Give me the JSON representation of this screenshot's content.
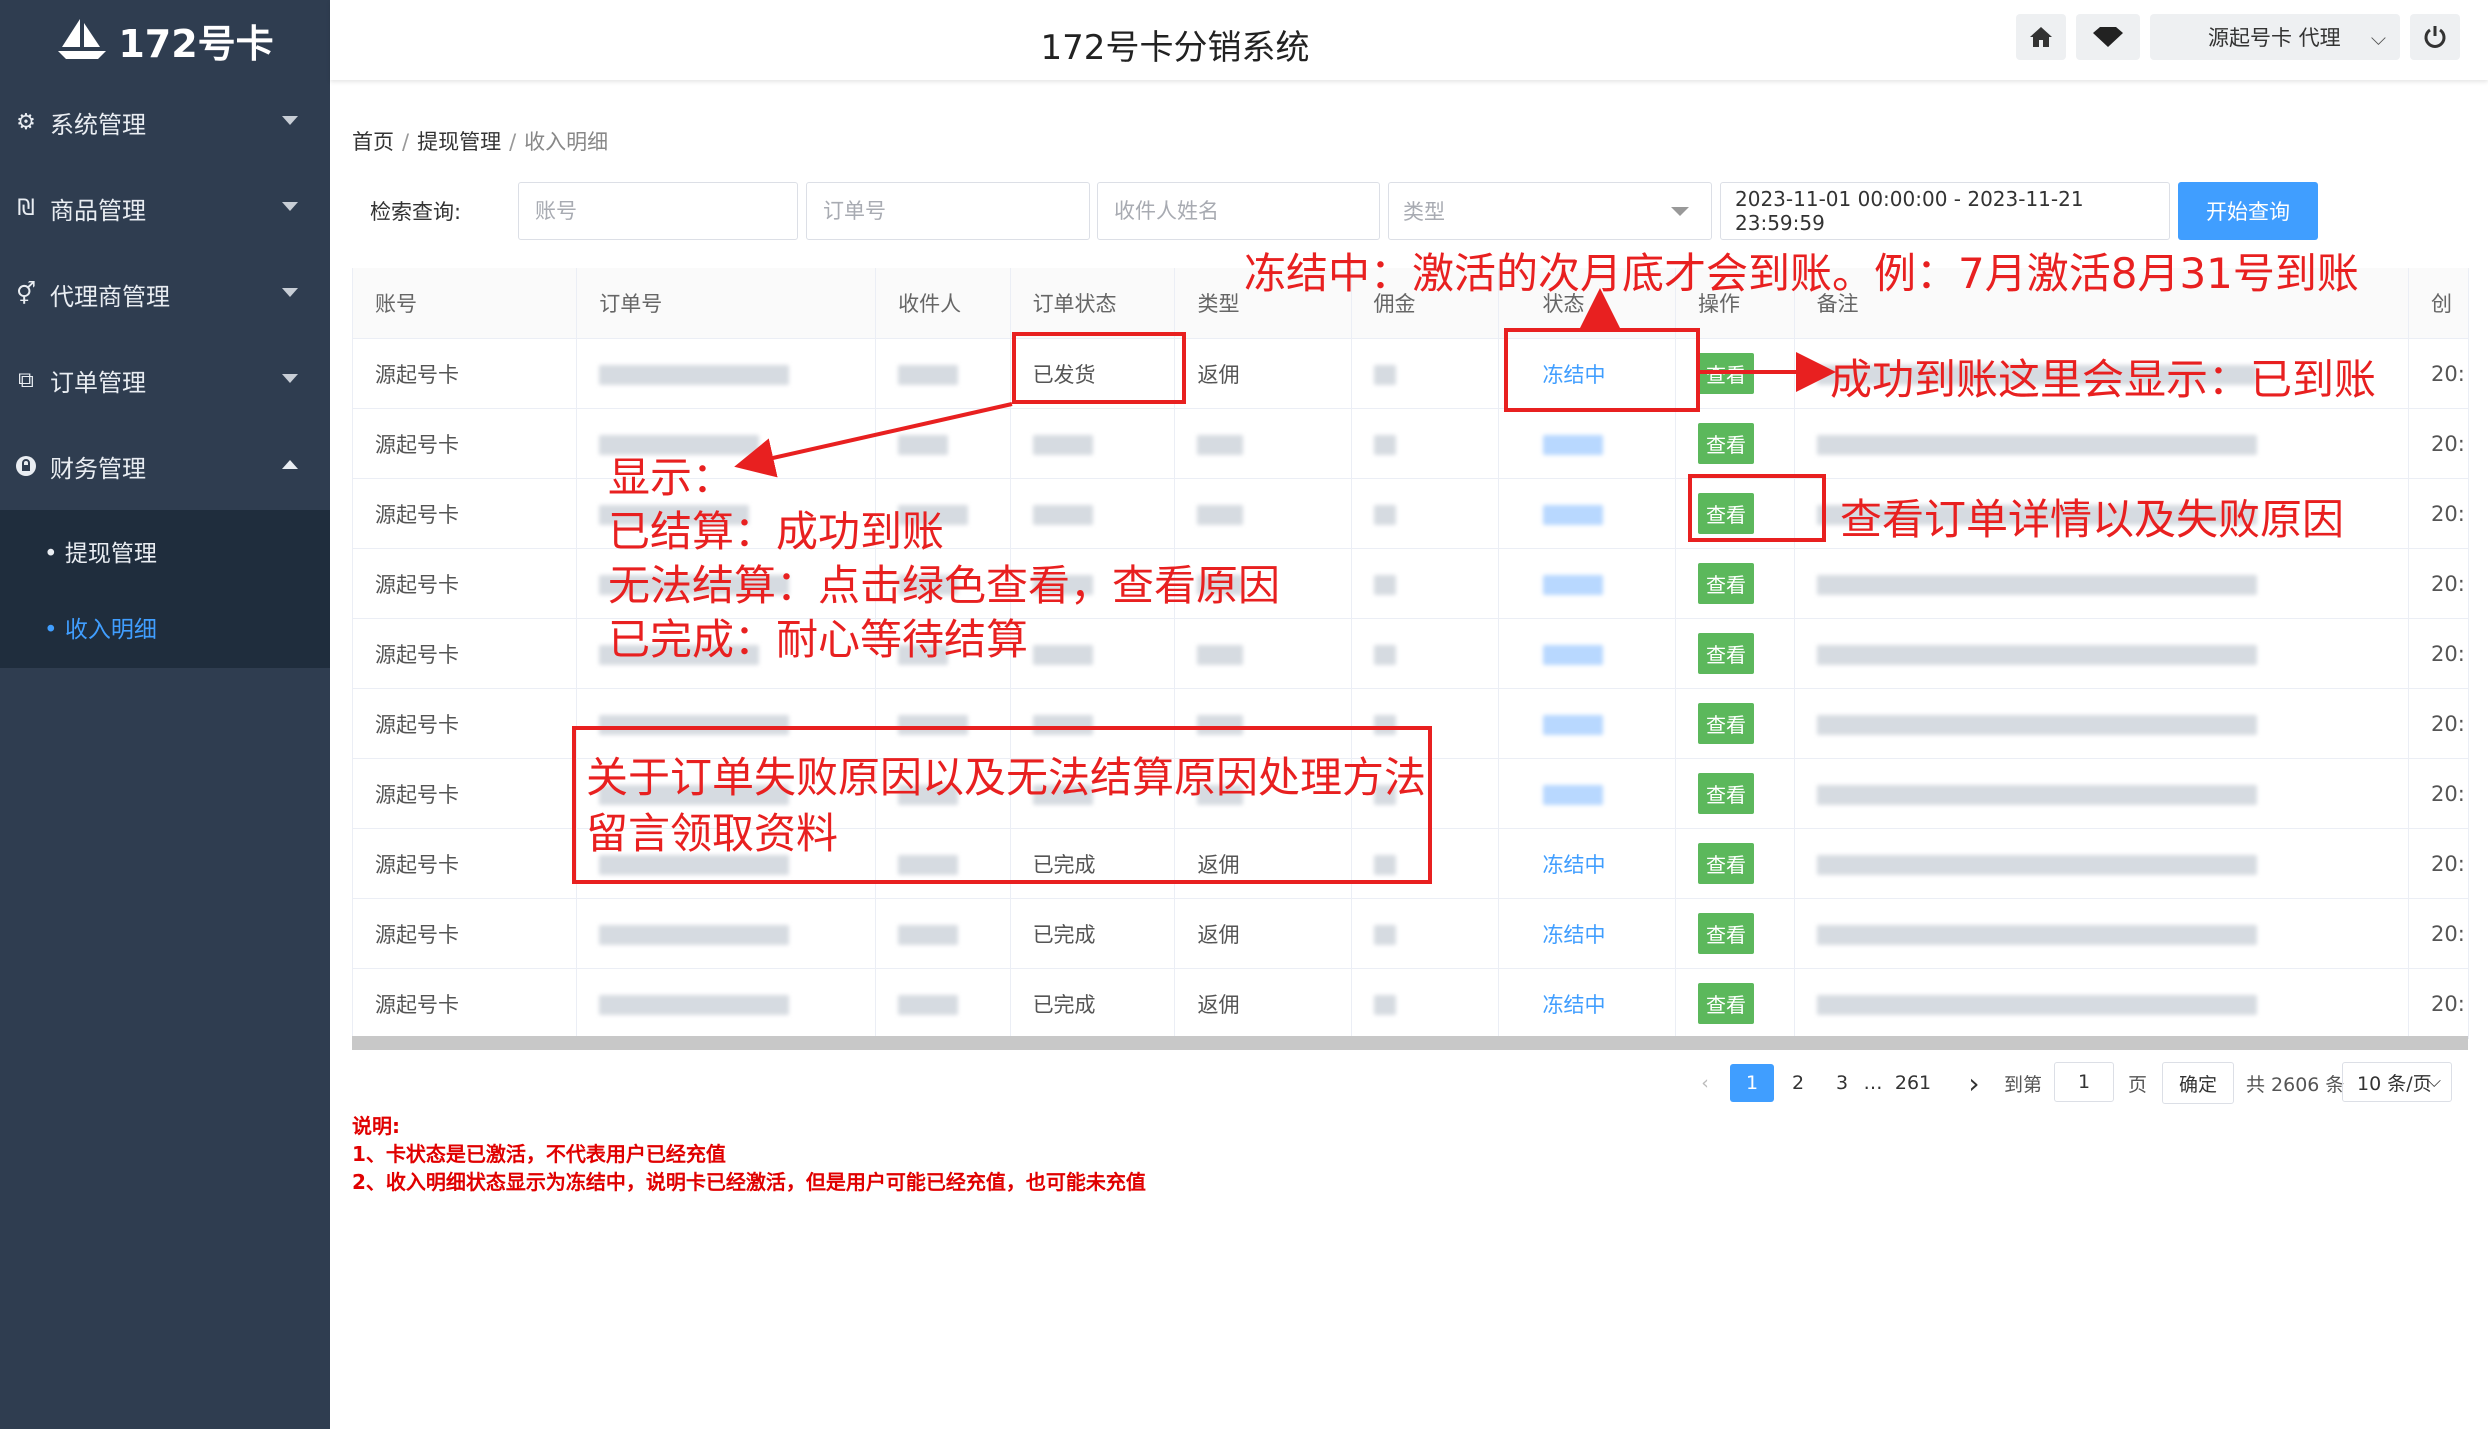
{
  "app": {
    "logo_text": "172号卡",
    "title": "172号卡分销系统",
    "user_label": "源起号卡 代理"
  },
  "sidebar": {
    "items": [
      {
        "label": "系统管理",
        "icon": "gear-icon"
      },
      {
        "label": "商品管理",
        "icon": "product-icon"
      },
      {
        "label": "代理商管理",
        "icon": "agent-icon"
      },
      {
        "label": "订单管理",
        "icon": "order-icon"
      },
      {
        "label": "财务管理",
        "icon": "finance-icon"
      }
    ],
    "sub_items": [
      {
        "label": "• 提现管理"
      },
      {
        "label": "• 收入明细",
        "active": true
      }
    ]
  },
  "breadcrumb": {
    "home": "首页",
    "sep": "/",
    "level2": "提现管理",
    "current": "收入明细"
  },
  "search": {
    "label": "检索查询:",
    "account_placeholder": "账号",
    "order_placeholder": "订单号",
    "recipient_placeholder": "收件人姓名",
    "type_placeholder": "类型",
    "date_range": "2023-11-01 00:00:00 - 2023-11-21 23:59:59",
    "button": "开始查询"
  },
  "table": {
    "columns": [
      "账号",
      "订单号",
      "收件人",
      "订单状态",
      "类型",
      "佣金",
      "状态",
      "操作",
      "备注",
      "创"
    ],
    "view_label": "查看",
    "rows": [
      {
        "account": "源起号卡",
        "order_status": "已发货",
        "type": "返佣",
        "status": "冻结中",
        "created": "20:"
      },
      {
        "account": "源起号卡",
        "order_status": "",
        "type": "",
        "status": "",
        "created": "20:"
      },
      {
        "account": "源起号卡",
        "order_status": "",
        "type": "",
        "status": "",
        "created": "20:"
      },
      {
        "account": "源起号卡",
        "order_status": "",
        "type": "",
        "status": "",
        "created": "20:"
      },
      {
        "account": "源起号卡",
        "order_status": "",
        "type": "",
        "status": "",
        "created": "20:"
      },
      {
        "account": "源起号卡",
        "order_status": "",
        "type": "",
        "status": "",
        "created": "20:"
      },
      {
        "account": "源起号卡",
        "order_status": "",
        "type": "",
        "status": "",
        "created": "20:"
      },
      {
        "account": "源起号卡",
        "order_status": "已完成",
        "type": "返佣",
        "status": "冻结中",
        "created": "20:"
      },
      {
        "account": "源起号卡",
        "order_status": "已完成",
        "type": "返佣",
        "status": "冻结中",
        "created": "20:"
      },
      {
        "account": "源起号卡",
        "order_status": "已完成",
        "type": "返佣",
        "status": "冻结中",
        "created": "20:"
      }
    ]
  },
  "pagination": {
    "pages": [
      "1",
      "2",
      "3",
      "…",
      "261"
    ],
    "current": "1",
    "goto_label": "到第",
    "goto_value": "1",
    "page_suffix": "页",
    "confirm": "确定",
    "total": "共 2606 条",
    "page_size": "10 条/页"
  },
  "notes": {
    "title": "说明:",
    "line1": "1、卡状态是已激活，不代表用户已经充值",
    "line2": "2、收入明细状态显示为冻结中，说明卡已经激活，但是用户可能已经充值，也可能未充值"
  },
  "annotations": {
    "frozen_note": "冻结中：激活的次月底才会到账。例：7月激活8月31号到账",
    "success_note": "成功到账这里会显示：已到账",
    "view_note": "查看订单详情以及失败原因",
    "show_title": "显示：",
    "show_line1": "已结算：成功到账",
    "show_line2": "无法结算：点击绿色查看，查看原因",
    "show_line3": "已完成：耐心等待结算",
    "contact_line1": "关于订单失败原因以及无法结算原因处理方法",
    "contact_line2": "留言领取资料",
    "color": "#e82020"
  },
  "colors": {
    "sidebar": "#2f3d50",
    "submenu": "#1f2d3d",
    "accent": "#409eff",
    "view_button": "#5cb85c",
    "note_red": "#e00000"
  }
}
